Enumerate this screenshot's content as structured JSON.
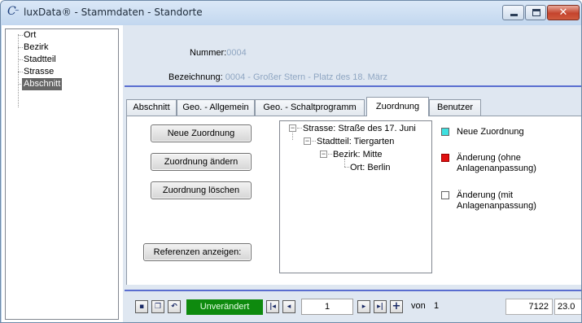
{
  "window": {
    "title": "luxData® - Stammdaten - Standorte",
    "app_icon": "luxdata-logo-icon",
    "controls": [
      "minimize-icon",
      "maximize-icon",
      "close-icon"
    ]
  },
  "left_tree": {
    "items": [
      {
        "label": "Ort",
        "selected": false
      },
      {
        "label": "Bezirk",
        "selected": false
      },
      {
        "label": "Stadtteil",
        "selected": false
      },
      {
        "label": "Strasse",
        "selected": false
      },
      {
        "label": "Abschnitt",
        "selected": true
      }
    ]
  },
  "header": {
    "nummer_label": "Nummer:",
    "nummer_value": "0004",
    "bezeichnung_label": "Bezeichnung:",
    "bezeichnung_value": "0004 - Großer Stern - Platz des 18. März"
  },
  "tabs": [
    {
      "label": "Abschnitt",
      "active": false
    },
    {
      "label": "Geo. - Allgemein",
      "active": false
    },
    {
      "label": "Geo. - Schaltprogramm",
      "active": false
    },
    {
      "label": "Zuordnung",
      "active": true
    },
    {
      "label": "Benutzer",
      "active": false
    }
  ],
  "zuordnung": {
    "buttons": {
      "neu": "Neue Zuordnung",
      "aendern": "Zuordnung ändern",
      "loeschen": "Zuordnung löschen",
      "referenzen": "Referenzen anzeigen:"
    },
    "tree": [
      {
        "label": "Strasse: Straße des 17. Juni",
        "level": 0,
        "expand": "−"
      },
      {
        "label": "Stadtteil: Tiergarten",
        "level": 1,
        "expand": "−"
      },
      {
        "label": "Bezirk: Mitte",
        "level": 2,
        "expand": "−"
      },
      {
        "label": "Ort: Berlin",
        "level": 3,
        "expand": ""
      }
    ],
    "legend": [
      {
        "label": "Neue Zuordnung",
        "color": "#3ee0e0"
      },
      {
        "label": "Änderung (ohne Anlagenanpassung)",
        "line1": "Änderung (ohne",
        "line2": "Anlagenanpassung)",
        "color": "#e01010"
      },
      {
        "label": "Änderung (mit Anlagenanpassung)",
        "line1": "Änderung (mit",
        "line2": "Anlagenanpassung)",
        "color": "#ffffff"
      }
    ]
  },
  "navigator": {
    "icons": [
      "save-icon",
      "copy-icon",
      "undo-icon"
    ],
    "status": "Unverändert",
    "status_color": "#0e8a0e",
    "first_icon": "first-record-icon",
    "prev_icon": "prev-record-icon",
    "current_record": "1",
    "next_icon": "next-record-icon",
    "last_icon": "last-record-icon",
    "add_icon": "add-record-icon",
    "von_label": "von",
    "total_records": "1",
    "field1": "7122",
    "field2": "23.0"
  }
}
